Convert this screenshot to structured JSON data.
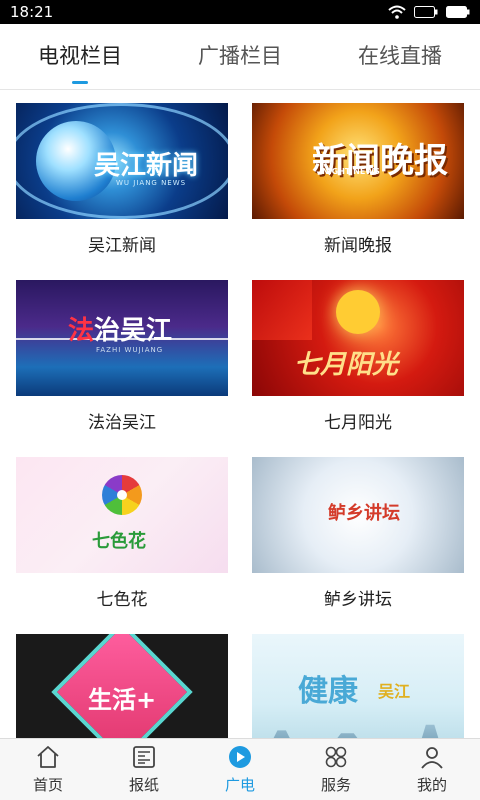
{
  "status_bar": {
    "time": "18:21"
  },
  "tabs": [
    {
      "label": "电视栏目",
      "active": true
    },
    {
      "label": "广播栏目",
      "active": false
    },
    {
      "label": "在线直播",
      "active": false
    }
  ],
  "programs": [
    {
      "title": "吴江新闻",
      "thumb_text": "吴江新闻",
      "thumb_sub": "WU JIANG NEWS"
    },
    {
      "title": "新闻晚报",
      "thumb_text": "新闻晚报",
      "thumb_sub": "NIGHT NEWS"
    },
    {
      "title": "法治吴江",
      "thumb_text_red": "法",
      "thumb_text": "治吴江",
      "thumb_sub": "FAZHI WUJIANG"
    },
    {
      "title": "七月阳光",
      "thumb_text": "七月阳光"
    },
    {
      "title": "七色花",
      "thumb_text": "七色花"
    },
    {
      "title": "鲈乡讲坛",
      "thumb_text": "鲈乡讲坛"
    },
    {
      "title": "",
      "thumb_text": "生活+"
    },
    {
      "title": "",
      "thumb_text": "健康",
      "thumb_sub": "吴江"
    }
  ],
  "bottom_nav": [
    {
      "label": "首页",
      "icon": "home-icon",
      "active": false
    },
    {
      "label": "报纸",
      "icon": "newspaper-icon",
      "active": false
    },
    {
      "label": "广电",
      "icon": "play-circle-icon",
      "active": true
    },
    {
      "label": "服务",
      "icon": "services-grid-icon",
      "active": false
    },
    {
      "label": "我的",
      "icon": "user-icon",
      "active": false
    }
  ],
  "colors": {
    "accent": "#1e9ae0",
    "text": "#222222"
  }
}
